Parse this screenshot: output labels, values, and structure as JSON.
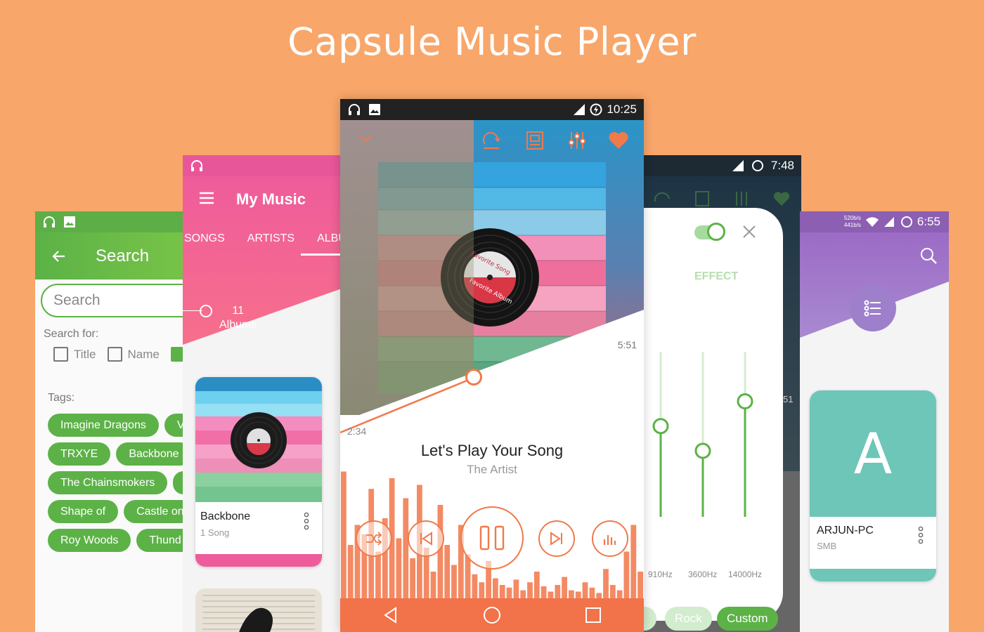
{
  "headline": "Capsule Music Player",
  "colors": {
    "background": "#f8a66a",
    "green": "#5cb247",
    "pink": "#ef5c9b",
    "orange": "#f07a4a",
    "purple": "#9c6bc6",
    "teal": "#6dc6b8"
  },
  "search_screen": {
    "title": "Search",
    "search_placeholder": "Search",
    "search_for_label": "Search for:",
    "options": [
      "Title",
      "Name"
    ],
    "tags_label": "Tags:",
    "tags": [
      [
        "Imagine Dragons",
        "V"
      ],
      [
        "TRXYE",
        "Backbone"
      ],
      [
        "The Chainsmokers",
        ""
      ],
      [
        "Shape of",
        "Castle on"
      ],
      [
        "Roy Woods",
        "Thund"
      ]
    ]
  },
  "library_screen": {
    "title": "My Music",
    "tabs": [
      "SONGS",
      "ARTISTS",
      "ALBU"
    ],
    "count_value": "11",
    "count_label": "Albums",
    "album_title": "Backbone",
    "album_sub": "1 Song"
  },
  "player_screen": {
    "clock": "10:25",
    "elapsed": "2:34",
    "duration": "5:51",
    "song_title": "Let's Play Your Song",
    "artist": "The Artist",
    "record_top": "Favorite Song",
    "record_bottom": "Favorite Album",
    "visualizer": [
      0.95,
      0.4,
      0.55,
      0.48,
      0.82,
      0.35,
      0.6,
      0.9,
      0.45,
      0.75,
      0.3,
      0.85,
      0.38,
      0.2,
      0.7,
      0.4,
      0.25,
      0.55,
      0.33,
      0.18,
      0.12,
      0.28,
      0.15,
      0.1,
      0.08,
      0.14,
      0.06,
      0.12,
      0.2,
      0.09,
      0.05,
      0.1,
      0.16,
      0.06,
      0.05,
      0.12,
      0.08,
      0.04,
      0.22,
      0.1,
      0.06,
      0.35,
      0.55,
      0.2
    ]
  },
  "equalizer_screen": {
    "clock": "7:48",
    "effect_label": "EFFECT",
    "peek_time": "51",
    "bands": [
      "910Hz",
      "3600Hz",
      "14000Hz"
    ],
    "band_levels": [
      0.55,
      0.4,
      0.7
    ],
    "presets": [
      "Rock",
      "Custom"
    ]
  },
  "network_screen": {
    "clock": "6:55",
    "speed_up": "520b/s",
    "speed_down": "441b/s",
    "device_letter": "A",
    "device_name": "ARJUN-PC",
    "device_type": "SMB"
  }
}
